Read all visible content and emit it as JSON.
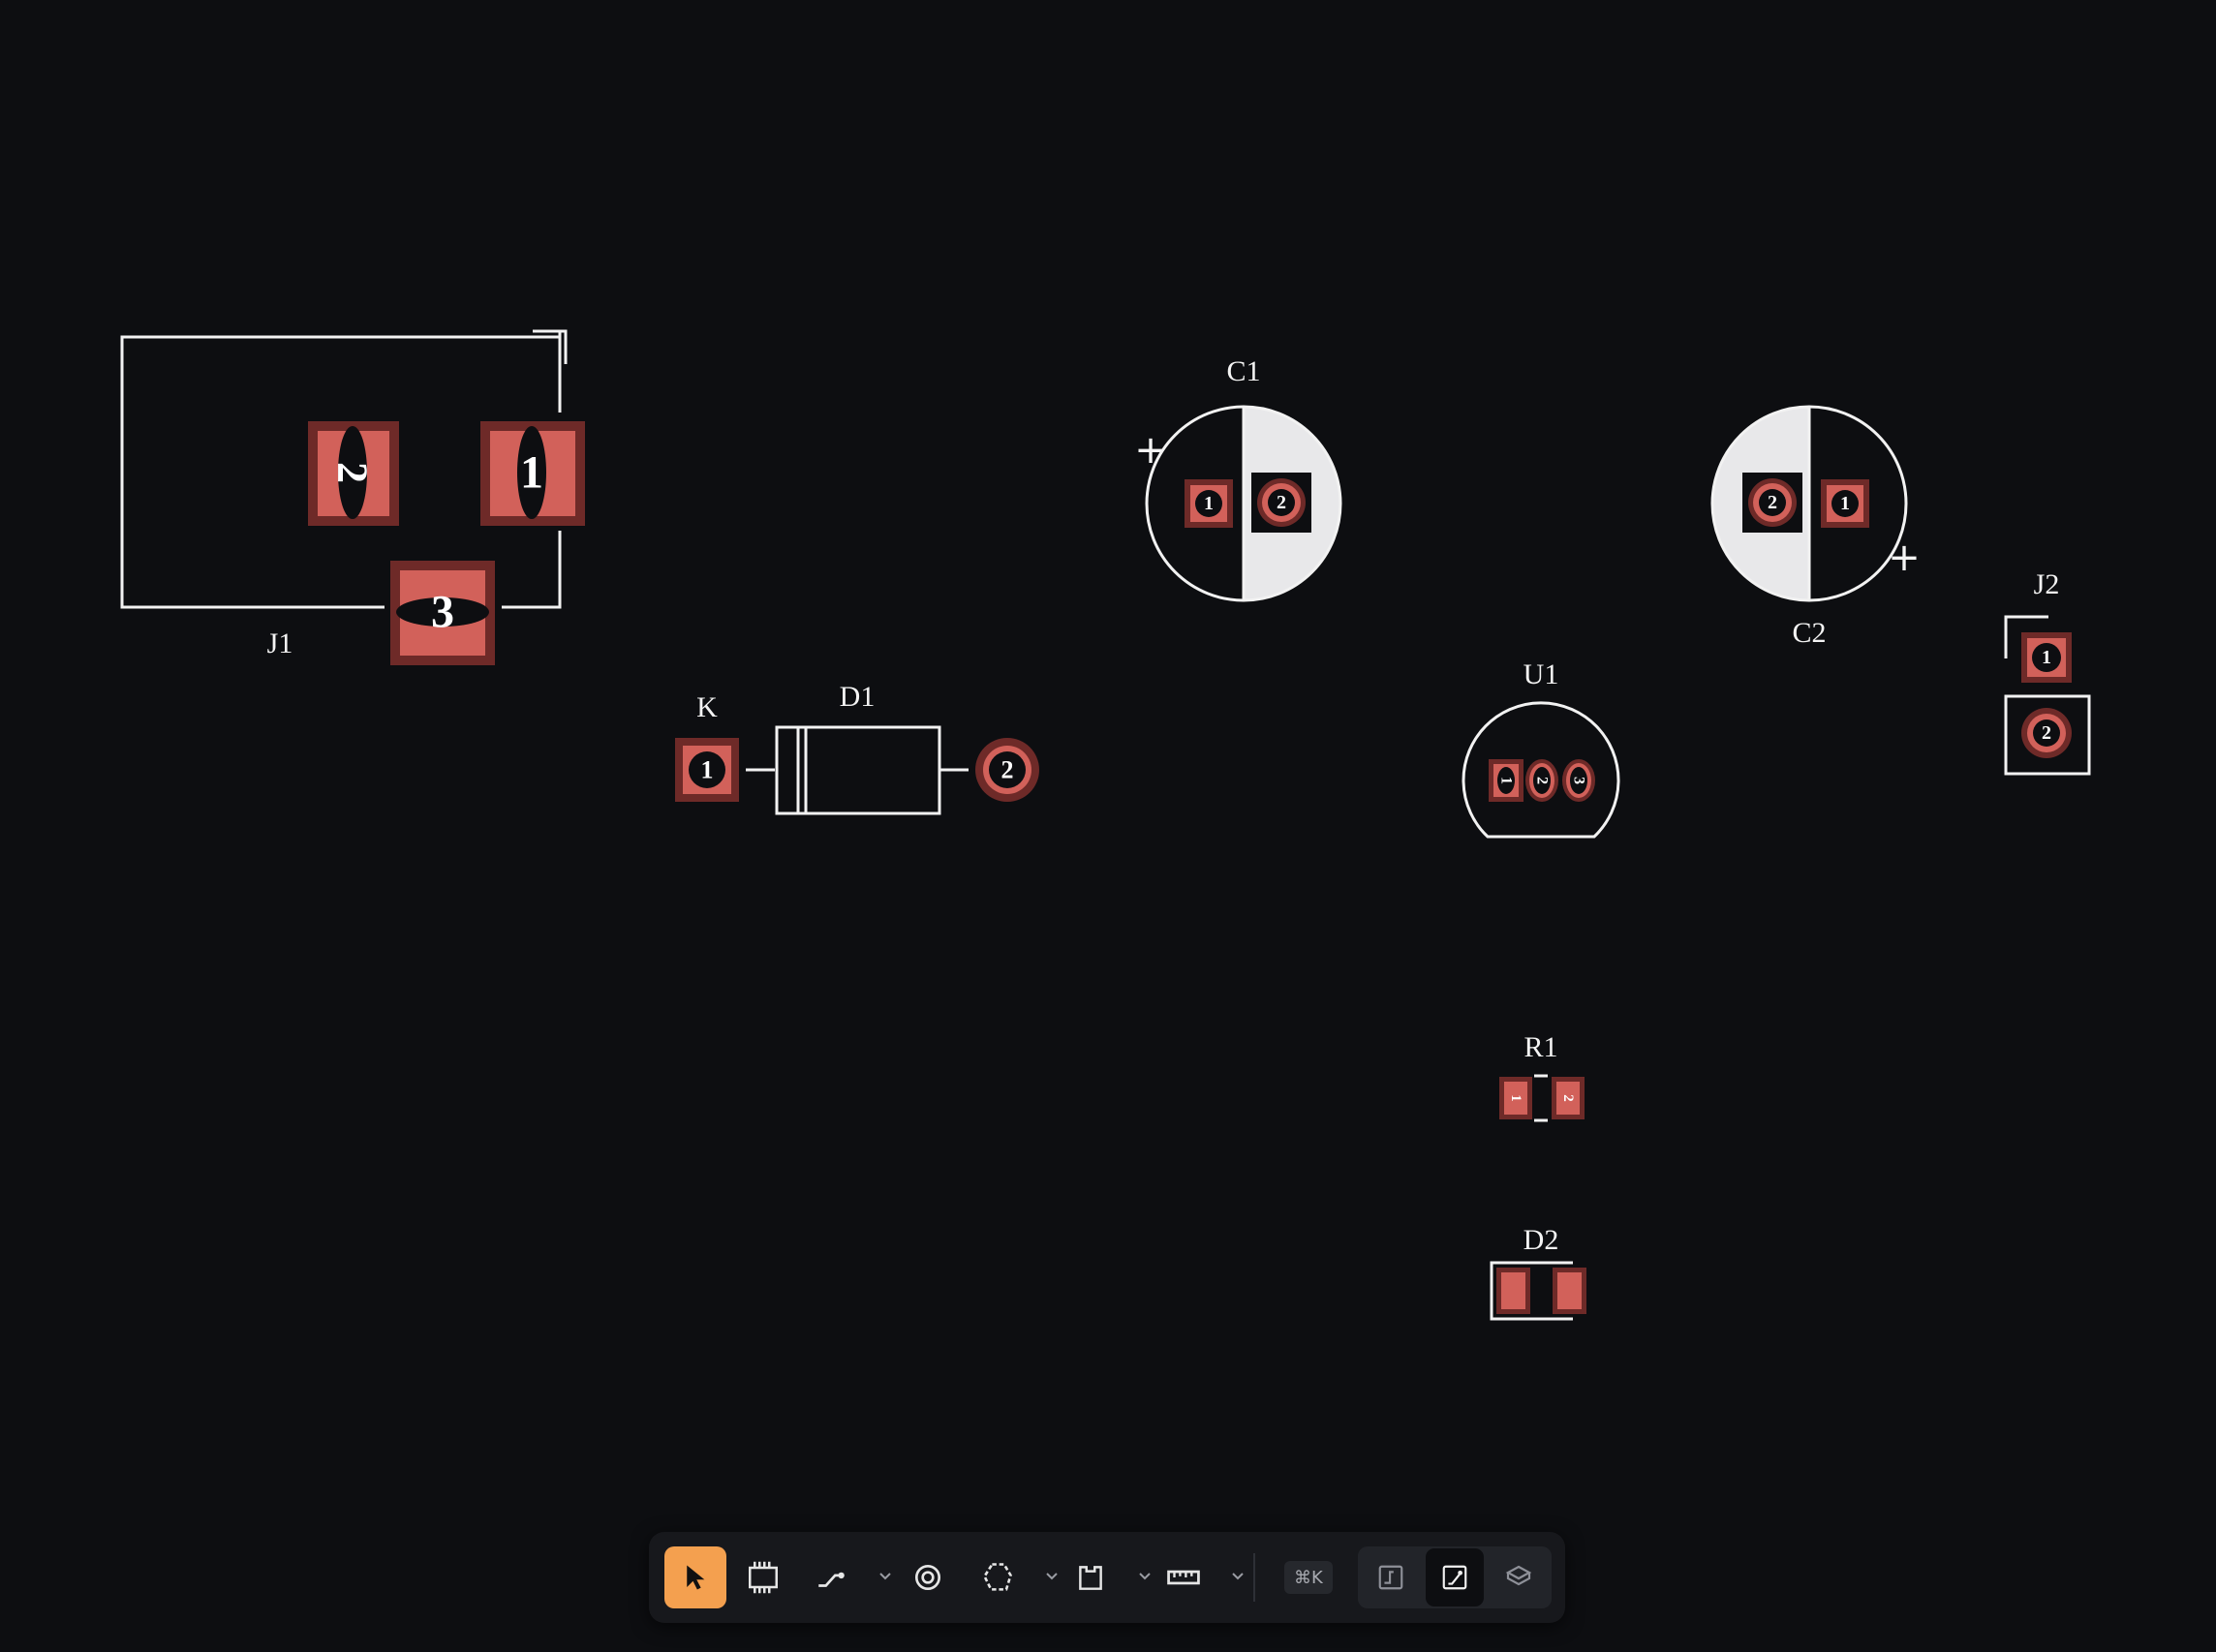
{
  "components": {
    "J1": {
      "ref": "J1",
      "pins": [
        "2",
        "1",
        "3"
      ]
    },
    "D1": {
      "ref": "D1",
      "cathode_label": "K",
      "pins": [
        "1",
        "2"
      ]
    },
    "C1": {
      "ref": "C1",
      "polarity": "+",
      "pins": [
        "1",
        "2"
      ]
    },
    "C2": {
      "ref": "C2",
      "polarity": "+",
      "pins": [
        "2",
        "1"
      ]
    },
    "J2": {
      "ref": "J2",
      "pins": [
        "1",
        "2"
      ]
    },
    "U1": {
      "ref": "U1",
      "pins": [
        "1",
        "2",
        "3"
      ]
    },
    "R1": {
      "ref": "R1",
      "pins": [
        "1",
        "2"
      ]
    },
    "D2": {
      "ref": "D2"
    }
  },
  "colors": {
    "background": "#0d0e11",
    "silkscreen": "#f2f2f2",
    "pad": "#d2615a",
    "pad_ring": "#6e2a28",
    "accent": "#f4a04f"
  },
  "toolbar": {
    "tools": [
      {
        "name": "select",
        "icon": "cursor-icon",
        "active": true
      },
      {
        "name": "footprint",
        "icon": "chip-icon"
      },
      {
        "name": "trace",
        "icon": "route-icon"
      },
      {
        "name": "via",
        "icon": "via-icon"
      },
      {
        "name": "polygon",
        "icon": "polygon-icon"
      },
      {
        "name": "board",
        "icon": "board-outline-icon"
      },
      {
        "name": "measure",
        "icon": "ruler-icon"
      }
    ],
    "shortcut": "⌘K",
    "view_modes": [
      {
        "name": "schematic",
        "icon": "schematic-icon"
      },
      {
        "name": "pcb",
        "icon": "pcb-icon",
        "active": true
      },
      {
        "name": "3d",
        "icon": "cube-icon"
      }
    ]
  }
}
